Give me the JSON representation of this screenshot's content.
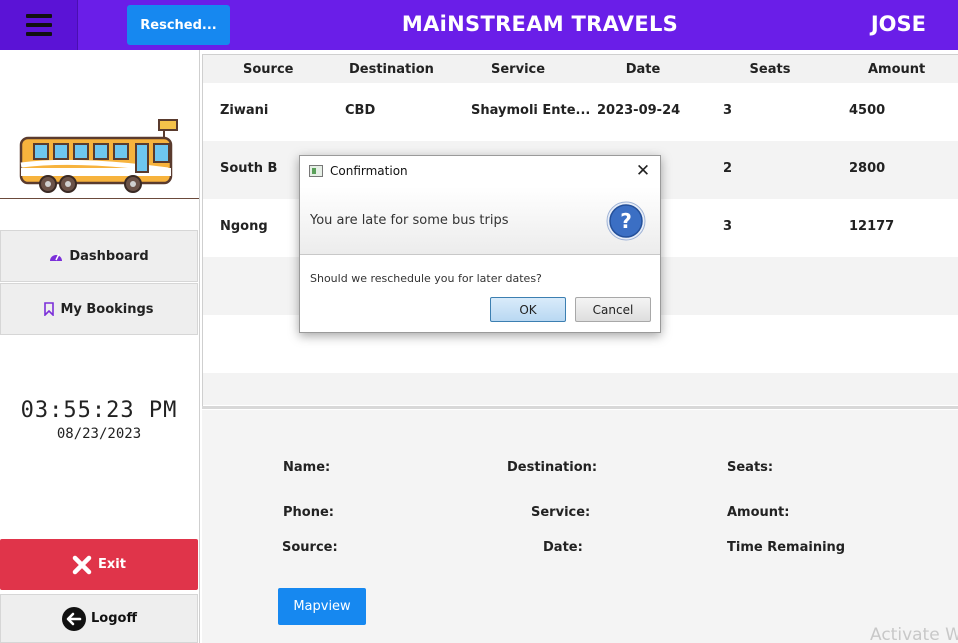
{
  "header": {
    "menu_icon": "hamburger-menu-icon",
    "reschedule_label": "Resched...",
    "title": "MAiNSTREAM TRAVELS",
    "user": "JOSE",
    "colors": {
      "header_bg": "#6a1ee8",
      "button_blue": "#1688f0"
    }
  },
  "sidebar": {
    "logo_icon": "bus-icon",
    "dashboard_label": "Dashboard",
    "bookings_label": "My Bookings",
    "clock": "03:55:23 PM",
    "date": "08/23/2023",
    "exit_label": "Exit",
    "logoff_label": "Logoff",
    "exit_color": "#e0344a"
  },
  "table": {
    "columns": [
      "Source",
      "Destination",
      "Service",
      "Date",
      "Seats",
      "Amount"
    ],
    "rows": [
      {
        "source": "Ziwani",
        "destination": "CBD",
        "service": "Shaymoli Ente...",
        "date": "2023-09-24",
        "seats": "3",
        "amount": "4500"
      },
      {
        "source": "South B",
        "destination": "",
        "service": "",
        "date": "",
        "seats": "2",
        "amount": "2800"
      },
      {
        "source": "Ngong",
        "destination": "",
        "service": "",
        "date": "",
        "seats": "3",
        "amount": "12177"
      }
    ]
  },
  "details": {
    "name_label": "Name:",
    "destination_label": "Destination:",
    "seats_label": "Seats:",
    "phone_label": "Phone:",
    "service_label": "Service:",
    "amount_label": "Amount:",
    "source_label": "Source:",
    "date_label": "Date:",
    "time_remaining_label": "Time Remaining",
    "mapview_label": "Mapview",
    "watermark": "Activate W"
  },
  "dialog": {
    "title": "Confirmation",
    "header_text": "You are late for some bus trips",
    "icon": "question-icon",
    "body": "Should we reschedule you for later dates?",
    "ok_label": "OK",
    "cancel_label": "Cancel"
  }
}
